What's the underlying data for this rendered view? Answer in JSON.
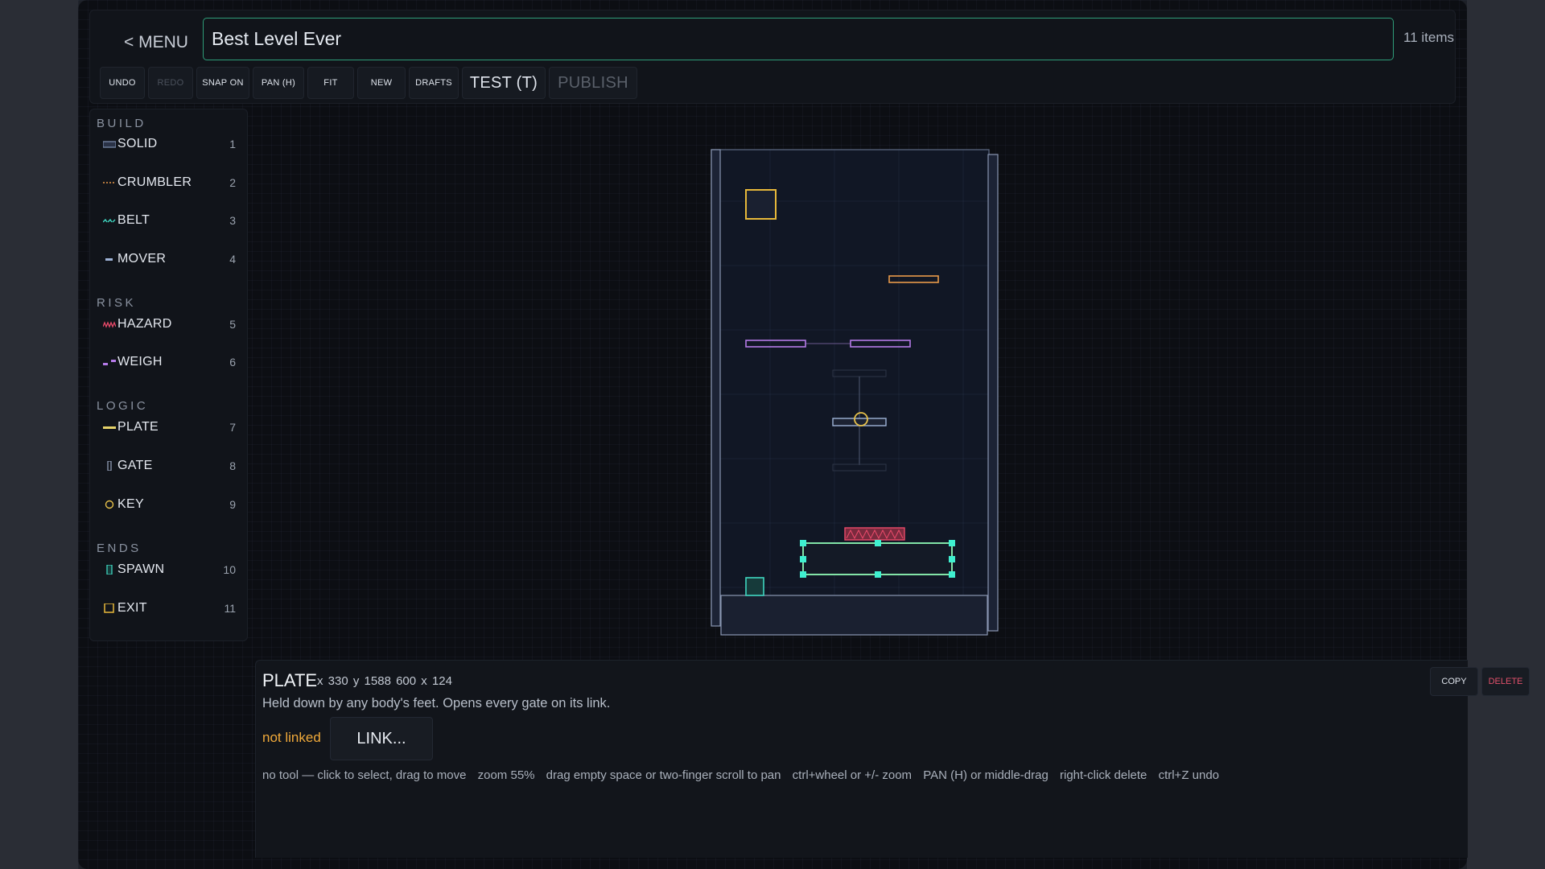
{
  "header": {
    "menu_label": "< MENU",
    "level_title": "Best Level Ever",
    "items_count": "11 items"
  },
  "toolbar": {
    "undo": "UNDO",
    "redo": "REDO",
    "snap": "SNAP ON",
    "pan": "PAN (H)",
    "fit": "FIT",
    "new": "NEW",
    "drafts": "DRAFTS",
    "test": "TEST  (T)",
    "publish": "PUBLISH"
  },
  "palette": {
    "sections": {
      "build": "BUILD",
      "risk": "RISK",
      "logic": "LOGIC",
      "ends": "ENDS"
    },
    "tools": [
      {
        "label": "SOLID",
        "key": "1",
        "icon": "solid-icon",
        "color": "#7f8fb0"
      },
      {
        "label": "CRUMBLER",
        "key": "2",
        "icon": "crumbler-icon",
        "color": "#e99a4a"
      },
      {
        "label": "BELT",
        "key": "3",
        "icon": "belt-icon",
        "color": "#3fd6c0"
      },
      {
        "label": "MOVER",
        "key": "4",
        "icon": "mover-icon",
        "color": "#9fb4d8"
      },
      {
        "label": "HAZARD",
        "key": "5",
        "icon": "hazard-icon",
        "color": "#ea4a6a"
      },
      {
        "label": "WEIGH",
        "key": "6",
        "icon": "weigh-icon",
        "color": "#b57ae8"
      },
      {
        "label": "PLATE",
        "key": "7",
        "icon": "plate-icon",
        "color": "#e6d36a"
      },
      {
        "label": "GATE",
        "key": "8",
        "icon": "gate-icon",
        "color": "#9aa6c0"
      },
      {
        "label": "KEY",
        "key": "9",
        "icon": "key-icon",
        "color": "#e7c14a"
      },
      {
        "label": "SPAWN",
        "key": "10",
        "icon": "spawn-icon",
        "color": "#3fd6c0"
      },
      {
        "label": "EXIT",
        "key": "11",
        "icon": "exit-icon",
        "color": "#e7b83a"
      }
    ]
  },
  "inspector": {
    "type": "PLATE",
    "x": "x 330",
    "y": "y 1588",
    "size": "600 x 124",
    "description": "Held down by any body's feet. Opens every gate on its link.",
    "link_status": "not linked",
    "link_button": "LINK...",
    "copy": "COPY",
    "delete": "DELETE"
  },
  "help": {
    "tool": "no tool — click to select, drag to move",
    "zoom": "zoom 55%",
    "pan": "drag empty space or two-finger scroll to pan",
    "zoom_keys": "ctrl+wheel or +/- zoom",
    "pan_key": "PAN (H) or middle-drag",
    "delete": "right-click delete",
    "undo": "ctrl+Z undo"
  },
  "colors": {
    "accent": "#2e9c78",
    "selection": "#3ff0d0",
    "warning": "#f0a93a",
    "danger": "#e0506a"
  }
}
